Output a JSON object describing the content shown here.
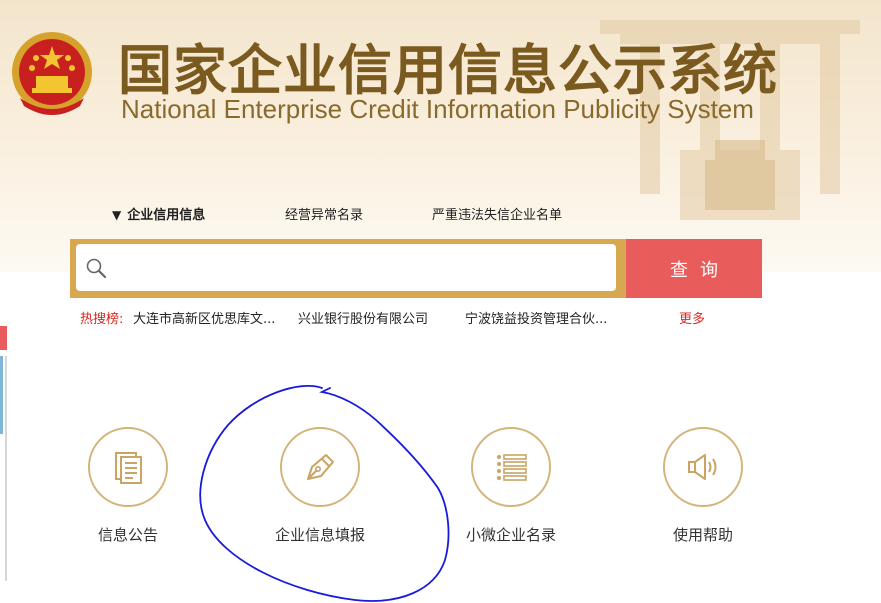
{
  "header": {
    "title_cn": "国家企业信用信息公示系统",
    "title_en": "National Enterprise Credit Information Publicity System"
  },
  "tabs": [
    {
      "label": "企业信用信息",
      "active": true
    },
    {
      "label": "经营异常名录",
      "active": false
    },
    {
      "label": "严重违法失信企业名单",
      "active": false
    }
  ],
  "search": {
    "placeholder": "",
    "value": "",
    "button_label": "查询"
  },
  "hot_search": {
    "label": "热搜榜:",
    "items": [
      "大连市高新区优思库文...",
      "兴业银行股份有限公司",
      "宁波饶益投资管理合伙..."
    ],
    "more_label": "更多"
  },
  "features": [
    {
      "label": "信息公告",
      "icon": "document-icon"
    },
    {
      "label": "企业信息填报",
      "icon": "pen-icon"
    },
    {
      "label": "小微企业名录",
      "icon": "list-icon"
    },
    {
      "label": "使用帮助",
      "icon": "speaker-icon"
    }
  ],
  "colors": {
    "brand_gold": "#d8a851",
    "title_brown": "#7a5a1f",
    "button_red": "#e85c5c",
    "hot_red": "#d9281f",
    "annotation_blue": "#1a1adb"
  }
}
